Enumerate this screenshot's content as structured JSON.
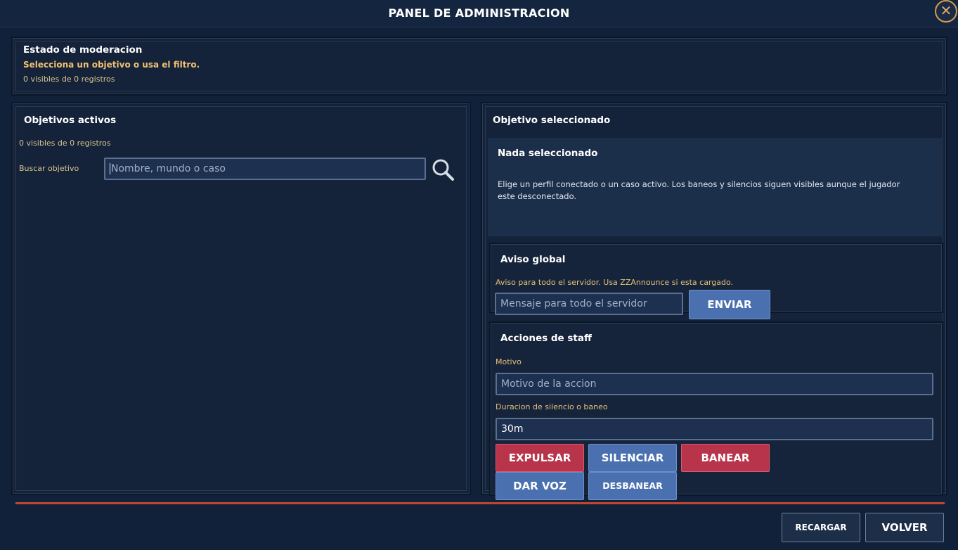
{
  "window": {
    "title": "PANEL DE ADMINISTRACION"
  },
  "status": {
    "title": "Estado de moderacion",
    "message": "Selecciona un objetivo o usa el filtro.",
    "count": "0 visibles de 0 registros"
  },
  "targets": {
    "title": "Objetivos activos",
    "count": "0 visibles de 0 registros",
    "search_label": "Buscar objetivo",
    "search_placeholder": "Nombre, mundo o caso",
    "search_value": ""
  },
  "selected": {
    "title": "Objetivo seleccionado",
    "heading": "Nada seleccionado",
    "description": "Elige un perfil conectado o un caso activo. Los baneos y silencios siguen visibles aunque el jugador este desconectado."
  },
  "announce": {
    "title": "Aviso global",
    "hint": "Aviso para todo el servidor. Usa ZZAnnounce si esta cargado.",
    "placeholder": "Mensaje para todo el servidor",
    "value": "",
    "send_label": "ENVIAR"
  },
  "actions": {
    "title": "Acciones de staff",
    "reason_label": "Motivo",
    "reason_placeholder": "Motivo de la accion",
    "reason_value": "",
    "duration_label": "Duracion de silencio o baneo",
    "duration_value": "30m",
    "kick_label": "EXPULSAR",
    "mute_label": "SILENCIAR",
    "ban_label": "BANEAR",
    "unmute_label": "DAR VOZ",
    "unban_label": "DESBANEAR"
  },
  "footer": {
    "reload_label": "RECARGAR",
    "back_label": "VOLVER"
  },
  "colors": {
    "background": "#12213a",
    "accent_gold": "#e7c07a",
    "button_blue": "#4a70b0",
    "button_red": "#b8344b",
    "divider": "#c0462e"
  },
  "icons": {
    "close": "close-icon",
    "search": "search-icon"
  }
}
